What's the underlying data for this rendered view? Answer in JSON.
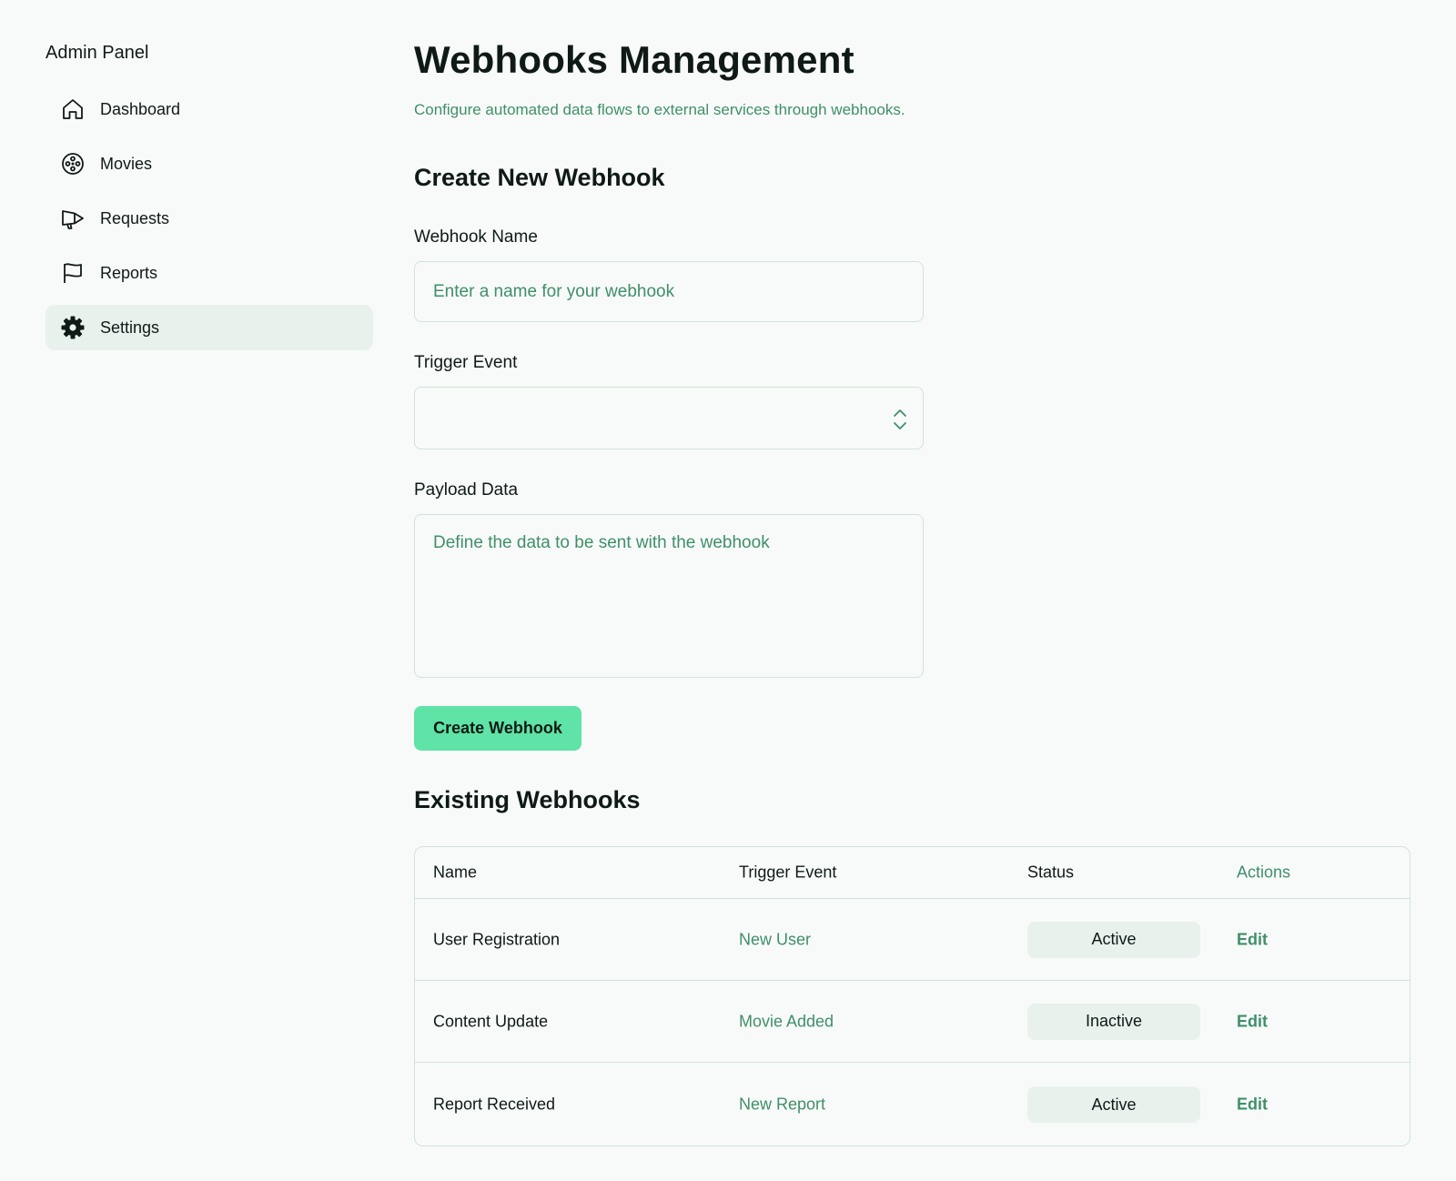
{
  "sidebar": {
    "brand": "Admin Panel",
    "items": [
      {
        "label": "Dashboard",
        "icon": "home-icon"
      },
      {
        "label": "Movies",
        "icon": "film-reel-icon"
      },
      {
        "label": "Requests",
        "icon": "megaphone-icon"
      },
      {
        "label": "Reports",
        "icon": "flag-icon"
      },
      {
        "label": "Settings",
        "icon": "gear-icon",
        "active": true
      }
    ]
  },
  "header": {
    "title": "Webhooks Management",
    "subtitle": "Configure automated data flows to external services through webhooks."
  },
  "create_form": {
    "section_title": "Create New Webhook",
    "name_label": "Webhook Name",
    "name_placeholder": "Enter a name for your webhook",
    "name_value": "",
    "trigger_label": "Trigger Event",
    "trigger_value": "",
    "payload_label": "Payload Data",
    "payload_placeholder": "Define the data to be sent with the webhook",
    "payload_value": "",
    "submit_label": "Create Webhook"
  },
  "existing": {
    "section_title": "Existing Webhooks",
    "columns": [
      "Name",
      "Trigger Event",
      "Status",
      "Actions"
    ],
    "rows": [
      {
        "name": "User Registration",
        "trigger": "New User",
        "status": "Active",
        "action": "Edit"
      },
      {
        "name": "Content Update",
        "trigger": "Movie Added",
        "status": "Inactive",
        "action": "Edit"
      },
      {
        "name": "Report Received",
        "trigger": "New Report",
        "status": "Active",
        "action": "Edit"
      }
    ]
  },
  "colors": {
    "background": "#f8faf9",
    "accent_text": "#3f8f6a",
    "primary_button": "#5fe3a6",
    "active_nav": "#e9f1ed",
    "border": "#cfe3d8"
  }
}
